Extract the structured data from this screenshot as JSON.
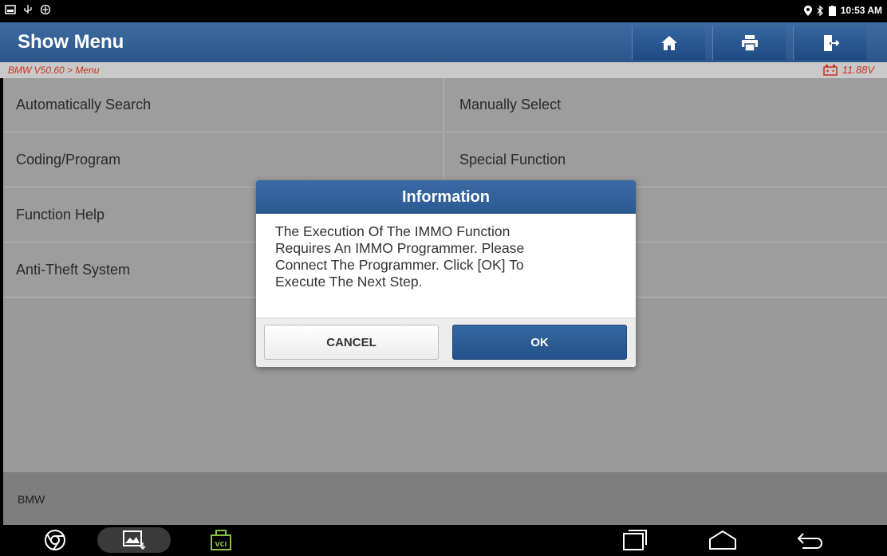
{
  "status_bar": {
    "time": "10:53 AM"
  },
  "header": {
    "title": "Show Menu",
    "home_icon": "home-icon",
    "print_icon": "printer-icon",
    "exit_icon": "exit-icon"
  },
  "breadcrumb": {
    "path": "BMW V50.60 > Menu",
    "voltage": "11.88V"
  },
  "menu": {
    "items": [
      "Automatically Search",
      "Manually Select",
      "Coding/Program",
      "Special Function",
      "Function Help",
      "Anti-Theft System"
    ]
  },
  "footer": {
    "label": "BMW"
  },
  "dialog": {
    "title": "Information",
    "message_lines": [
      "The Execution Of The IMMO Function",
      "Requires An IMMO Programmer. Please",
      "Connect The Programmer. Click [OK] To",
      "Execute The Next Step."
    ],
    "cancel_label": "CANCEL",
    "ok_label": "OK"
  },
  "nav_bar": {
    "vci_label": "VCI"
  },
  "colors": {
    "header_blue": "#2c5689",
    "breadcrumb_red": "#c8321e",
    "menu_gray": "#9d9d9d"
  }
}
